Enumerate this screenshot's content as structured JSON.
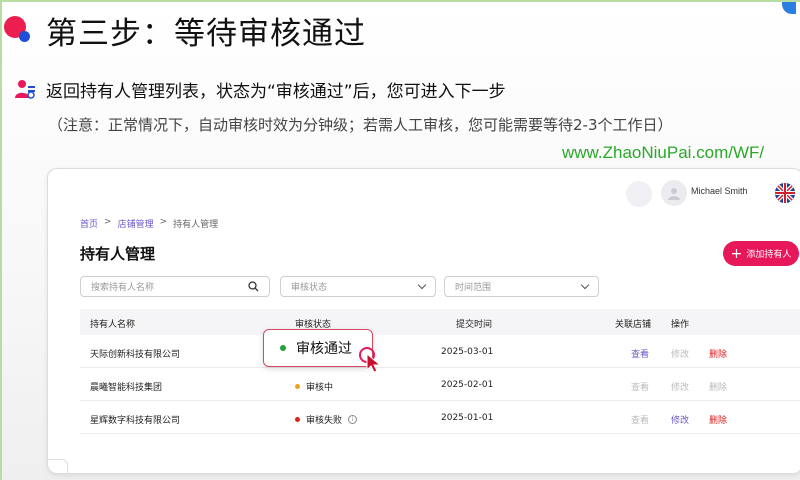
{
  "slide": {
    "title": "第三步：等待审核通过",
    "step_text": "返回持有人管理列表，状态为“审核通过”后，您可进入下一步",
    "note_text": "（注意：正常情况下，自动审核时效为分钟级；若需人工审核，您可能需要等待2-3个工作日）",
    "watermark": "www.ZhaoNiuPai.com/WF/"
  },
  "header": {
    "user_name": "Michael Smith"
  },
  "breadcrumb": {
    "home": "首页",
    "sep": ">",
    "store": "店铺管理",
    "current": "持有人管理"
  },
  "page": {
    "heading": "持有人管理",
    "add_button": "添加持有人"
  },
  "filters": {
    "search_placeholder": "搜索持有人名称",
    "status_placeholder": "审核状态",
    "time_placeholder": "时间范围"
  },
  "table": {
    "columns": {
      "name": "持有人名称",
      "status": "审核状态",
      "submitted": "提交时间",
      "store": "关联店铺",
      "actions": "操作"
    },
    "rows": [
      {
        "name": "天际创新科技有限公司",
        "status": "审核通过",
        "date": "2025-03-01",
        "view": "查看",
        "edit": "修改",
        "delete": "删除"
      },
      {
        "name": "晨曦智能科技集团",
        "status": "审核中",
        "date": "2025-02-01",
        "view": "查看",
        "edit": "修改",
        "delete": "删除"
      },
      {
        "name": "星辉数字科技有限公司",
        "status": "审核失败",
        "date": "2025-01-01",
        "view": "查看",
        "edit": "修改",
        "delete": "删除"
      }
    ]
  },
  "colors": {
    "accent": "#e6185a",
    "link": "#6b57c9",
    "approved": "#1fa33a",
    "pending": "#f0a020",
    "failed": "#e02020",
    "watermark": "#2aa82a"
  }
}
